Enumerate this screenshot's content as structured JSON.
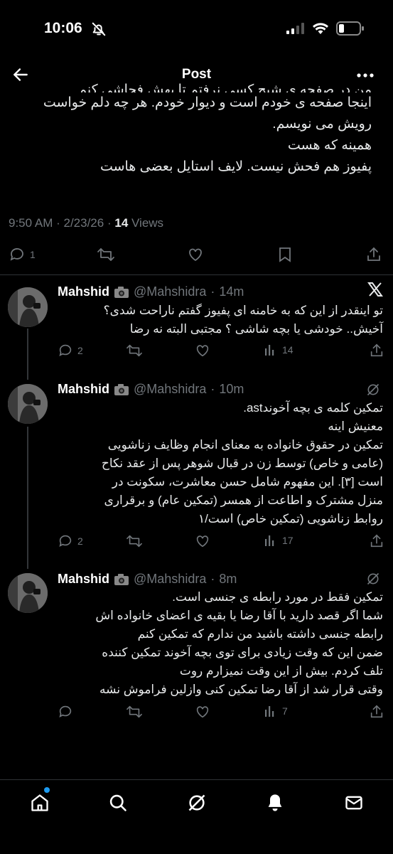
{
  "status_bar": {
    "time": "10:06"
  },
  "header": {
    "title": "Post"
  },
  "main_post": {
    "lines": [
      "من در صفحه ی شیچ کسی نرفتم تا بهش فحاشی کنم",
      "اینجا صفحه ی خودم است و دیوار خودم. هر چه دلم خواست",
      "رویش می نویسم.",
      "همینه که هست",
      "پفیوز هم فحش نیست. لایف استایل بعضی هاست"
    ],
    "time": "9:50 AM",
    "date": "2/23/26",
    "views_count": "14",
    "views_label": "Views",
    "reply_count": "1"
  },
  "replies": [
    {
      "name": "Mahshid",
      "handle": "@Mahshidra",
      "time": "14m",
      "lines": [
        "تو اینقدر از این که به خامنه ای پفیوز گفتم ناراحت شدی؟",
        "آخیش.. خودشی یا بچه شاشی ؟ مجتبی البته نه رضا"
      ],
      "replies": "2",
      "views": "14"
    },
    {
      "name": "Mahshid",
      "handle": "@Mahshidra",
      "time": "10m",
      "lines": [
        "تمکین کلمه ی بچه آخوندast.",
        "معنیش اینه",
        "تمکین در حقوق خانواده به معنای انجام وظایف زناشویی",
        "(عامی و خاص) توسط زن در قبال شوهر پس از عقد نکاح",
        "است [۳]. این مفهوم شامل حسن معاشرت، سکونت در",
        "منزل مشترک و اطاعت از همسر (تمکین عام) و برقراری",
        "روابط زناشویی (تمکین خاص) است/۱"
      ],
      "replies": "2",
      "views": "17"
    },
    {
      "name": "Mahshid",
      "handle": "@Mahshidra",
      "time": "8m",
      "lines": [
        "تمکین فقط در مورد رابطه ی جنسی است.",
        "شما اگر قصد دارید با آقا رضا یا بقیه ی اعضای خانواده اش",
        "رابطه جنسی داشته باشید من ندارم که تمکین کنم",
        "ضمن این که وقت زیادی برای توی بچه آخوند تمکین کننده",
        "تلف کردم. بیش از این وقت نمیزارم روت",
        "وقتی قرار شد از آقا رضا تمکین کنی وازلین فراموش نشه"
      ],
      "replies": "",
      "views": "7"
    }
  ],
  "nav": [
    "home-icon",
    "search-icon",
    "grok-icon",
    "notifications-icon",
    "messages-icon"
  ],
  "colors": {
    "accent": "#1d9bf0",
    "muted": "#71767b",
    "text": "#e7e9ea"
  }
}
